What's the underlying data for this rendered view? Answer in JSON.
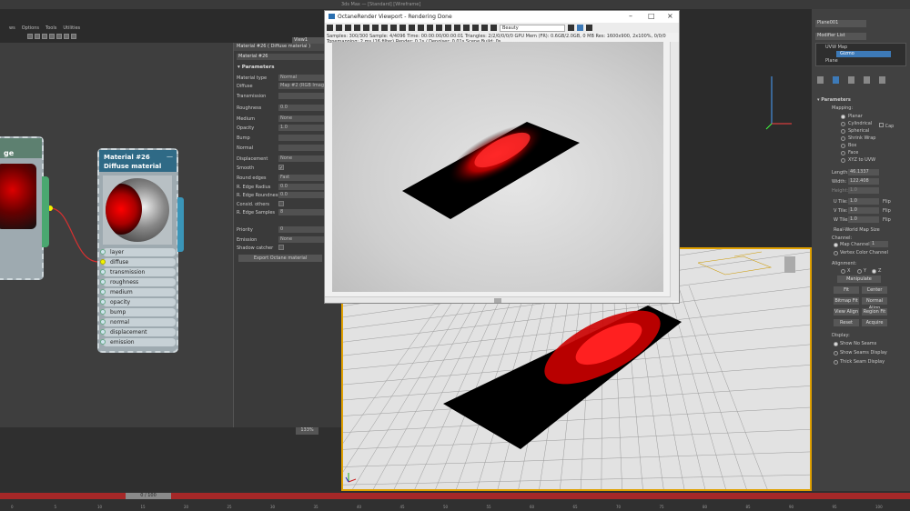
{
  "app": {
    "window_title": "3ds Max — [Standard] [Wireframe]",
    "menu": [
      "ws",
      "Options",
      "Tools",
      "Utilities"
    ]
  },
  "node_left": {
    "title": "ge"
  },
  "material_node": {
    "title": "Material #26",
    "subtitle": "Diffuse material",
    "minimize": "—",
    "pins": [
      "layer",
      "diffuse",
      "transmission",
      "roughness",
      "medium",
      "opacity",
      "bump",
      "normal",
      "displacement",
      "emission"
    ],
    "selected_pin": "diffuse"
  },
  "material_panel": {
    "tab": "Material #26  ( Diffuse material )",
    "name_field": "Material #26",
    "section": "Parameters",
    "view_label": "View1",
    "rows": [
      {
        "label": "Material type",
        "value": "Normal"
      },
      {
        "label": "Diffuse",
        "value": "Map #2 (RGB Imag"
      },
      {
        "label": "Transmission",
        "value": ""
      },
      {
        "label": "Roughness",
        "value": "0.0"
      },
      {
        "label": "Medium",
        "value": "None"
      },
      {
        "label": "Opacity",
        "value": "1.0"
      },
      {
        "label": "Bump",
        "value": ""
      },
      {
        "label": "Normal",
        "value": ""
      },
      {
        "label": "Displacement",
        "value": "None"
      },
      {
        "label": "Smooth",
        "value": "✓"
      },
      {
        "label": "Round edges",
        "value": "Fast"
      },
      {
        "label": "R. Edge Radius",
        "value": "0.0"
      },
      {
        "label": "R. Edge Roundness",
        "value": "0.0"
      },
      {
        "label": "Consid. others",
        "value": ""
      },
      {
        "label": "R. Edge Samples",
        "value": "8"
      },
      {
        "label": "Priority",
        "value": "0"
      },
      {
        "label": "Emission",
        "value": "None"
      },
      {
        "label": "Shadow catcher",
        "value": ""
      }
    ],
    "export_button": "Export Octane material",
    "zoom": "133%"
  },
  "octane_viewport": {
    "title": "OctaneRender Viewport - Rendering Done",
    "kernel": "Beauty",
    "stats_line1": "Samples: 300/300    Sample: 4/4096    Time: 00:00:00/00:00:01    Triangles: 2/2/0/0/0/0    GPU Mem (FR): 0.6GB/2.0GB, 0 MB    Res: 1600x900, 2x100%, 0/0/0",
    "stats_line2": "Tonemapping: 2 ms (16 filter)    Render: 0.1s / Denoiser: 0.01s    Scene Build: 0s"
  },
  "modifier_panel": {
    "object_name": "Plane001",
    "modifier_list": "Modifier List",
    "stack": [
      "UVW Map",
      "Gizmo",
      "Plane"
    ],
    "params_title": "Parameters",
    "mapping_label": "Mapping:",
    "mapping_options": [
      "Planar",
      "Cylindrical",
      "Spherical",
      "Shrink Wrap",
      "Box",
      "Face",
      "XYZ to UVW"
    ],
    "mapping_selected": "Planar",
    "cap": "Cap",
    "length_label": "Length:",
    "length_value": "46.1337",
    "width_label": "Width:",
    "width_value": "122.408",
    "height_label": "Height:",
    "height_value": "1.0",
    "utile_label": "U Tile:",
    "utile_value": "1.0",
    "vtile_label": "V Tile:",
    "vtile_value": "1.0",
    "wtile_label": "W Tile:",
    "wtile_value": "1.0",
    "flip": "Flip",
    "real_world": "Real-World Map Size",
    "channel_label": "Channel:",
    "map_channel": "Map Channel:",
    "map_channel_value": "1",
    "vertex_color": "Vertex Color Channel",
    "alignment_label": "Alignment:",
    "axes": [
      "X",
      "Y",
      "Z"
    ],
    "manipulate": "Manipulate",
    "buttons": [
      "Fit",
      "Center",
      "Bitmap Fit",
      "Normal Align",
      "View Align",
      "Region Fit",
      "Reset",
      "Acquire"
    ],
    "display_label": "Display:",
    "display_options": [
      "Show No Seams",
      "Show Seams Display",
      "Thick Seam Display"
    ]
  },
  "timeline": {
    "frame": "0 / 100",
    "ticks": [
      "0",
      "5",
      "10",
      "15",
      "20",
      "25",
      "30",
      "35",
      "40",
      "45",
      "50",
      "55",
      "60",
      "65",
      "70",
      "75",
      "80",
      "85",
      "90",
      "95",
      "100"
    ]
  },
  "colors": {
    "accent": "#3d7ab8",
    "selection_border": "#e0a000",
    "timeline_red": "#a52828",
    "node_header": "#2f6a86",
    "wire": "#d83030"
  }
}
